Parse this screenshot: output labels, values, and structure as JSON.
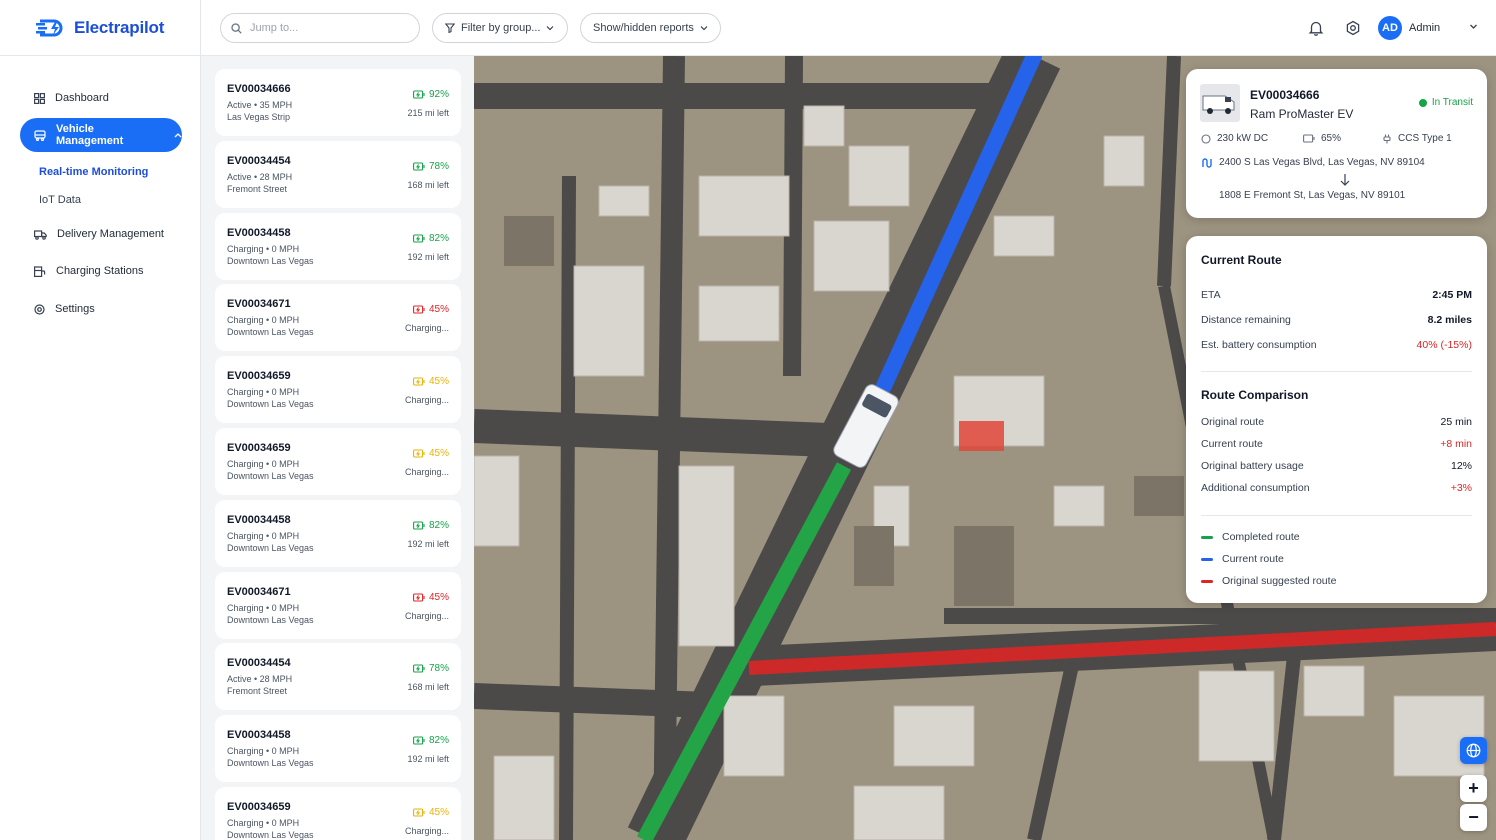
{
  "brand": {
    "name": "Electrapilot",
    "color": "#1a6ef5"
  },
  "nav": {
    "items": [
      {
        "label": "Dashboard",
        "icon": "grid-icon"
      },
      {
        "label": "Vehicle Management",
        "icon": "bus-icon",
        "active": true
      },
      {
        "label": "Delivery Management",
        "icon": "truck-icon"
      },
      {
        "label": "Charging Stations",
        "icon": "charger-icon"
      },
      {
        "label": "Settings",
        "icon": "gear-icon"
      }
    ],
    "subitems": [
      {
        "label": "Real-time Monitoring",
        "active": true
      },
      {
        "label": "IoT Data"
      }
    ]
  },
  "topbar": {
    "search_placeholder": "Jump to...",
    "filter_label": "Filter by group...",
    "reports_label": "Show/hidden reports",
    "user_initials": "AD",
    "user_name": "Admin"
  },
  "vehicles": [
    {
      "id": "EV00034666",
      "status": "Active • 35 MPH",
      "location": "Las Vegas Strip",
      "battery": "92%",
      "battery_color": "#16a34a",
      "range": "215 mi left"
    },
    {
      "id": "EV00034454",
      "status": "Active • 28 MPH",
      "location": "Fremont Street",
      "battery": "78%",
      "battery_color": "#16a34a",
      "range": "168 mi left"
    },
    {
      "id": "EV00034458",
      "status": "Charging • 0 MPH",
      "location": "Downtown Las Vegas",
      "battery": "82%",
      "battery_color": "#16a34a",
      "range": "192 mi left"
    },
    {
      "id": "EV00034671",
      "status": "Charging • 0 MPH",
      "location": "Downtown Las Vegas",
      "battery": "45%",
      "battery_color": "#dc2626",
      "range": "Charging..."
    },
    {
      "id": "EV00034659",
      "status": "Charging • 0 MPH",
      "location": "Downtown Las Vegas",
      "battery": "45%",
      "battery_color": "#eab308",
      "range": "Charging..."
    },
    {
      "id": "EV00034659",
      "status": "Charging • 0 MPH",
      "location": "Downtown Las Vegas",
      "battery": "45%",
      "battery_color": "#eab308",
      "range": "Charging..."
    },
    {
      "id": "EV00034458",
      "status": "Charging • 0 MPH",
      "location": "Downtown Las Vegas",
      "battery": "82%",
      "battery_color": "#16a34a",
      "range": "192 mi left"
    },
    {
      "id": "EV00034671",
      "status": "Charging • 0 MPH",
      "location": "Downtown Las Vegas",
      "battery": "45%",
      "battery_color": "#dc2626",
      "range": "Charging..."
    },
    {
      "id": "EV00034454",
      "status": "Active • 28 MPH",
      "location": "Fremont Street",
      "battery": "78%",
      "battery_color": "#16a34a",
      "range": "168 mi left"
    },
    {
      "id": "EV00034458",
      "status": "Charging • 0 MPH",
      "location": "Downtown Las Vegas",
      "battery": "82%",
      "battery_color": "#16a34a",
      "range": "192 mi left"
    },
    {
      "id": "EV00034659",
      "status": "Charging • 0 MPH",
      "location": "Downtown Las Vegas",
      "battery": "45%",
      "battery_color": "#eab308",
      "range": "Charging..."
    }
  ],
  "selected": {
    "id": "EV00034666",
    "model": "Ram ProMaster EV",
    "status": "In Transit",
    "charger": "230 kW DC",
    "battery": "65%",
    "connector": "CCS Type 1",
    "from": "2400 S Las Vegas Blvd, Las Vegas, NV 89104",
    "to": "1808 E Fremont St, Las Vegas, NV 89101"
  },
  "route": {
    "title": "Current Route",
    "eta_label": "ETA",
    "eta": "2:45 PM",
    "distance_label": "Distance remaining",
    "distance": "8.2 miles",
    "consumption_label": "Est. battery consumption",
    "consumption": "40% (-15%)",
    "comparison_title": "Route Comparison",
    "original_route_label": "Original route",
    "original_route": "25 min",
    "current_route_label": "Current route",
    "current_route": "+8 min",
    "orig_battery_label": "Original battery usage",
    "orig_battery": "12%",
    "additional_label": "Additional consumption",
    "additional": "+3%",
    "legend": [
      {
        "label": "Completed route",
        "color": "#16a34a"
      },
      {
        "label": "Current route",
        "color": "#2563eb"
      },
      {
        "label": "Original suggested route",
        "color": "#dc2626"
      }
    ]
  },
  "map_controls": {
    "zoom_in": "+",
    "zoom_out": "−"
  }
}
